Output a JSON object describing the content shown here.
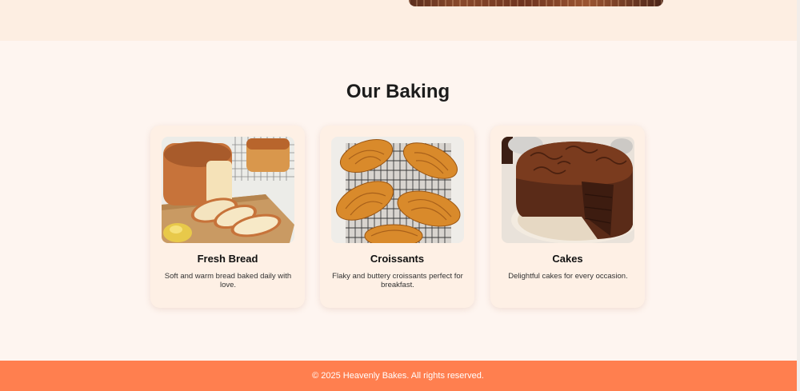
{
  "hero": {
    "image_icon": "hero-bakery-image"
  },
  "section": {
    "title": "Our Baking"
  },
  "cards": [
    {
      "icon": "bread-image",
      "title": "Fresh Bread",
      "description": "Soft and warm bread baked daily with love."
    },
    {
      "icon": "croissant-image",
      "title": "Croissants",
      "description": "Flaky and buttery croissants perfect for breakfast."
    },
    {
      "icon": "cake-image",
      "title": "Cakes",
      "description": "Delightful cakes for every occasion."
    }
  ],
  "footer": {
    "text": "© 2025 Heavenly Bakes. All rights reserved."
  },
  "colors": {
    "accent": "#ff7f4f",
    "page_background": "#fef5f0",
    "card_background": "#fef0e5"
  }
}
